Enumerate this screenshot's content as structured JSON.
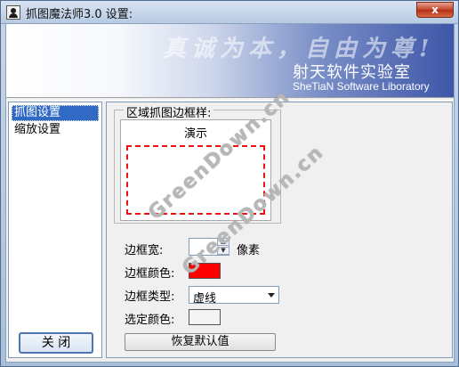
{
  "window": {
    "title": "抓图魔法师3.0 设置:",
    "close_glyph": "x"
  },
  "banner": {
    "motto": "真诚为本，自由为尊!",
    "lab_name": "射天软件实验室",
    "lab_name_en": "SheTiaN Software Liboratory"
  },
  "sidebar": {
    "items": [
      {
        "label": "抓图设置",
        "active": true
      },
      {
        "label": "缩放设置",
        "active": false
      }
    ],
    "close_button": "关 闭"
  },
  "panel": {
    "group_title": "区域抓图边框样:",
    "preview_label": "演示",
    "border_width_label": "边框宽:",
    "border_width_value": "",
    "border_width_unit": "像素",
    "border_color_label": "边框颜色:",
    "border_color": "#ff0000",
    "border_type_label": "边框类型:",
    "border_type_value": "虚线",
    "selected_color_label": "选定颜色:",
    "selected_color": "#f4f4f4",
    "restore_button": "恢复默认值"
  },
  "watermark": {
    "text": "GreenDown.cn"
  }
}
